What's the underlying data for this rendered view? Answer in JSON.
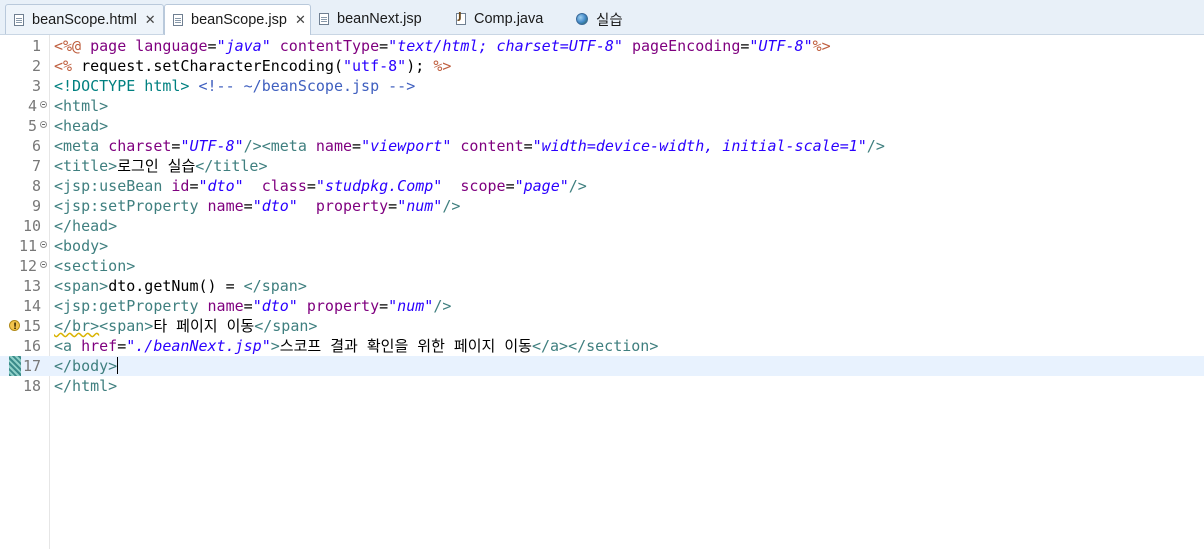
{
  "tabs": [
    {
      "label": "beanScope.html",
      "icon": "file-icon",
      "active": false,
      "closable": true
    },
    {
      "label": "beanScope.jsp",
      "icon": "file-icon",
      "active": true,
      "closable": true
    },
    {
      "label": "beanNext.jsp",
      "icon": "file-icon",
      "active": false,
      "closable": false
    },
    {
      "label": "Comp.java",
      "icon": "java-file-icon",
      "active": false,
      "closable": false
    },
    {
      "label": "실습",
      "icon": "web-browser-globe-icon",
      "active": false,
      "closable": false
    }
  ],
  "close_glyph": "✕",
  "colors": {
    "tag": "#3f7f7f",
    "attribute": "#7f007f",
    "value": "#2a00ff",
    "scriptlet": "#bf5f3f",
    "comment": "#3f5fbf",
    "doctype": "#008080",
    "text": "#000000",
    "current_line_bg": "#e8f2fe"
  },
  "editor": {
    "current_line": 17,
    "lines": [
      {
        "n": "1",
        "fold": false,
        "marker": "",
        "tokens": [
          {
            "t": "<%@",
            "k": "scriptlet"
          },
          {
            "t": " ",
            "k": "text"
          },
          {
            "t": "page",
            "k": "attribute"
          },
          {
            "t": " ",
            "k": "text"
          },
          {
            "t": "language",
            "k": "attribute"
          },
          {
            "t": "=",
            "k": "text"
          },
          {
            "t": "\"java\"",
            "k": "value"
          },
          {
            "t": " ",
            "k": "text"
          },
          {
            "t": "contentType",
            "k": "attribute"
          },
          {
            "t": "=",
            "k": "text"
          },
          {
            "t": "\"text/html; charset=UTF-8\"",
            "k": "value"
          },
          {
            "t": " ",
            "k": "text"
          },
          {
            "t": "pageEncoding",
            "k": "attribute"
          },
          {
            "t": "=",
            "k": "text"
          },
          {
            "t": "\"UTF-8\"",
            "k": "value"
          },
          {
            "t": "%>",
            "k": "scriptlet"
          }
        ]
      },
      {
        "n": "2",
        "fold": false,
        "marker": "",
        "tokens": [
          {
            "t": "<%",
            "k": "scriptlet"
          },
          {
            "t": " request.setCharacterEncoding(",
            "k": "text"
          },
          {
            "t": "\"utf-8\"",
            "k": "value"
          },
          {
            "t": "); ",
            "k": "text"
          },
          {
            "t": "%>",
            "k": "scriptlet"
          }
        ]
      },
      {
        "n": "3",
        "fold": false,
        "marker": "",
        "tokens": [
          {
            "t": "<!DOCTYPE html>",
            "k": "doctype"
          },
          {
            "t": " ",
            "k": "text"
          },
          {
            "t": "<!-- ~/beanScope.jsp -->",
            "k": "comment"
          }
        ]
      },
      {
        "n": "4",
        "fold": true,
        "marker": "",
        "tokens": [
          {
            "t": "<html>",
            "k": "tag"
          }
        ]
      },
      {
        "n": "5",
        "fold": true,
        "marker": "",
        "tokens": [
          {
            "t": "<head>",
            "k": "tag"
          }
        ]
      },
      {
        "n": "6",
        "fold": false,
        "marker": "",
        "tokens": [
          {
            "t": "<meta",
            "k": "tag"
          },
          {
            "t": " ",
            "k": "text"
          },
          {
            "t": "charset",
            "k": "attribute"
          },
          {
            "t": "=",
            "k": "text"
          },
          {
            "t": "\"UTF-8\"",
            "k": "value"
          },
          {
            "t": "/>",
            "k": "tag"
          },
          {
            "t": "<meta",
            "k": "tag"
          },
          {
            "t": " ",
            "k": "text"
          },
          {
            "t": "name",
            "k": "attribute"
          },
          {
            "t": "=",
            "k": "text"
          },
          {
            "t": "\"viewport\"",
            "k": "value"
          },
          {
            "t": " ",
            "k": "text"
          },
          {
            "t": "content",
            "k": "attribute"
          },
          {
            "t": "=",
            "k": "text"
          },
          {
            "t": "\"width=device-width, initial-scale=1\"",
            "k": "value"
          },
          {
            "t": "/>",
            "k": "tag"
          }
        ]
      },
      {
        "n": "7",
        "fold": false,
        "marker": "",
        "tokens": [
          {
            "t": "<title>",
            "k": "tag"
          },
          {
            "t": "로그인 실습",
            "k": "text"
          },
          {
            "t": "</title>",
            "k": "tag"
          }
        ]
      },
      {
        "n": "8",
        "fold": false,
        "marker": "",
        "tokens": [
          {
            "t": "<jsp:useBean",
            "k": "tag"
          },
          {
            "t": " ",
            "k": "text"
          },
          {
            "t": "id",
            "k": "attribute"
          },
          {
            "t": "=",
            "k": "text"
          },
          {
            "t": "\"dto\"",
            "k": "value"
          },
          {
            "t": "  ",
            "k": "text"
          },
          {
            "t": "class",
            "k": "attribute"
          },
          {
            "t": "=",
            "k": "text"
          },
          {
            "t": "\"studpkg.Comp\"",
            "k": "value"
          },
          {
            "t": "  ",
            "k": "text"
          },
          {
            "t": "scope",
            "k": "attribute"
          },
          {
            "t": "=",
            "k": "text"
          },
          {
            "t": "\"page\"",
            "k": "value"
          },
          {
            "t": "/>",
            "k": "tag"
          }
        ]
      },
      {
        "n": "9",
        "fold": false,
        "marker": "",
        "tokens": [
          {
            "t": "<jsp:setProperty",
            "k": "tag"
          },
          {
            "t": " ",
            "k": "text"
          },
          {
            "t": "name",
            "k": "attribute"
          },
          {
            "t": "=",
            "k": "text"
          },
          {
            "t": "\"dto\"",
            "k": "value"
          },
          {
            "t": "  ",
            "k": "text"
          },
          {
            "t": "property",
            "k": "attribute"
          },
          {
            "t": "=",
            "k": "text"
          },
          {
            "t": "\"num\"",
            "k": "value"
          },
          {
            "t": "/>",
            "k": "tag"
          }
        ]
      },
      {
        "n": "10",
        "fold": false,
        "marker": "",
        "tokens": [
          {
            "t": "</head>",
            "k": "tag"
          }
        ]
      },
      {
        "n": "11",
        "fold": true,
        "marker": "",
        "tokens": [
          {
            "t": "<body>",
            "k": "tag"
          }
        ]
      },
      {
        "n": "12",
        "fold": true,
        "marker": "",
        "tokens": [
          {
            "t": "<section>",
            "k": "tag"
          }
        ]
      },
      {
        "n": "13",
        "fold": false,
        "marker": "",
        "tokens": [
          {
            "t": "<span>",
            "k": "tag"
          },
          {
            "t": "dto.getNum() = ",
            "k": "text"
          },
          {
            "t": "</span>",
            "k": "tag"
          }
        ]
      },
      {
        "n": "14",
        "fold": false,
        "marker": "",
        "tokens": [
          {
            "t": "<jsp:getProperty",
            "k": "tag"
          },
          {
            "t": " ",
            "k": "text"
          },
          {
            "t": "name",
            "k": "attribute"
          },
          {
            "t": "=",
            "k": "text"
          },
          {
            "t": "\"dto\"",
            "k": "value"
          },
          {
            "t": " ",
            "k": "text"
          },
          {
            "t": "property",
            "k": "attribute"
          },
          {
            "t": "=",
            "k": "text"
          },
          {
            "t": "\"num\"",
            "k": "value"
          },
          {
            "t": "/>",
            "k": "tag"
          }
        ]
      },
      {
        "n": "15",
        "fold": false,
        "marker": "warning",
        "tokens": [
          {
            "t": "</br>",
            "k": "tag"
          },
          {
            "t": "<span>",
            "k": "tag"
          },
          {
            "t": "타 페이지 이동",
            "k": "text"
          },
          {
            "t": "</span>",
            "k": "tag"
          }
        ]
      },
      {
        "n": "16",
        "fold": false,
        "marker": "",
        "tokens": [
          {
            "t": "<a",
            "k": "tag"
          },
          {
            "t": " ",
            "k": "text"
          },
          {
            "t": "href",
            "k": "attribute"
          },
          {
            "t": "=",
            "k": "text"
          },
          {
            "t": "\"./beanNext.jsp\"",
            "k": "value"
          },
          {
            "t": ">",
            "k": "tag"
          },
          {
            "t": "스코프 결과 확인을 위한 페이지 이동",
            "k": "text"
          },
          {
            "t": "</a>",
            "k": "tag"
          },
          {
            "t": "</section>",
            "k": "tag"
          }
        ]
      },
      {
        "n": "17",
        "fold": false,
        "marker": "change",
        "tokens": [
          {
            "t": "</body>",
            "k": "tag"
          }
        ]
      },
      {
        "n": "18",
        "fold": false,
        "marker": "",
        "tokens": [
          {
            "t": "</html>",
            "k": "tag"
          }
        ]
      }
    ]
  }
}
